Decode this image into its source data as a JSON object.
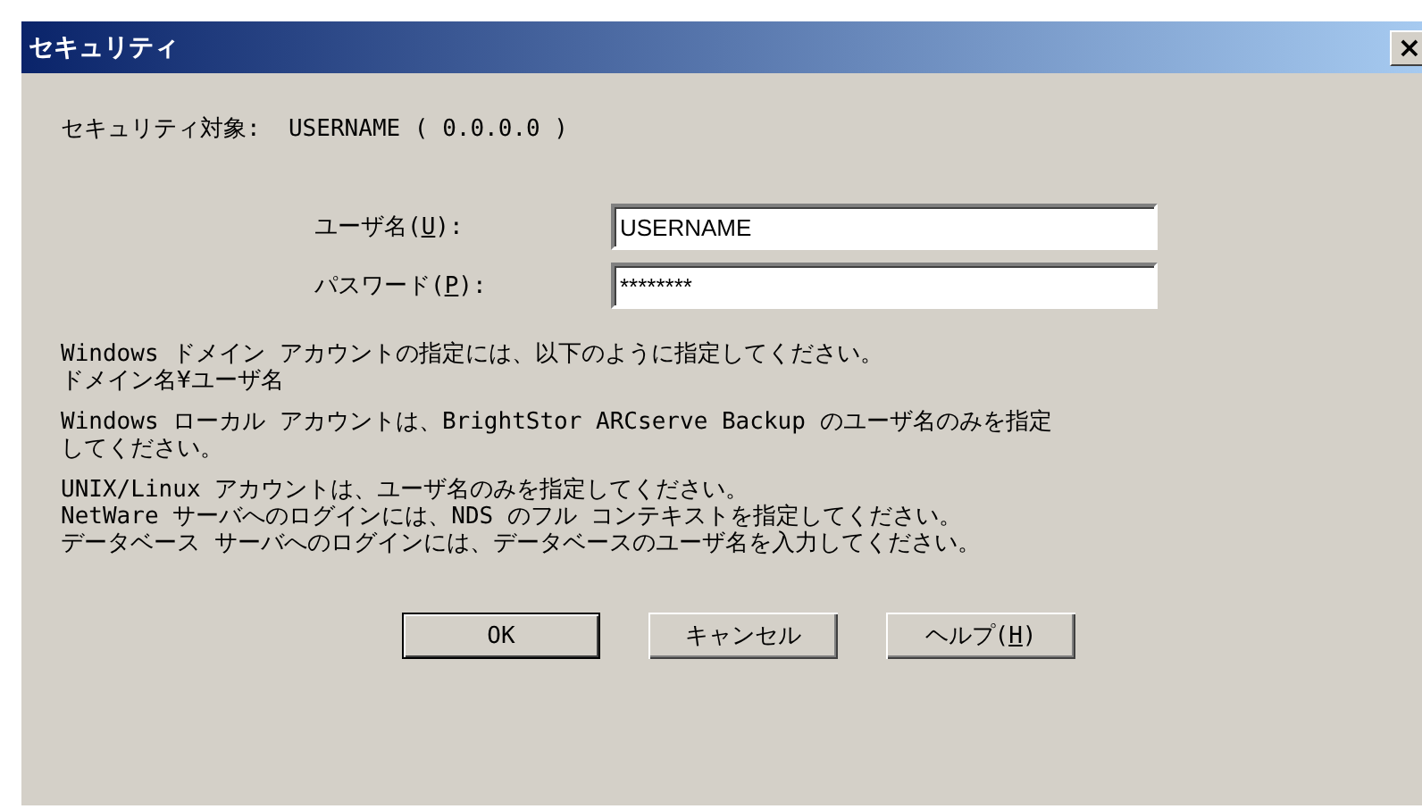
{
  "window": {
    "title": "セキュリティ",
    "close": "×"
  },
  "target": "セキュリティ対象:  USERNAME ( 0.0.0.0 )",
  "fields": [
    {
      "label": {
        "before": "ユーザ名(",
        "key": "U",
        "after": "):"
      },
      "value": "USERNAME"
    },
    {
      "label": {
        "before": "パスワード(",
        "key": "P",
        "after": "):"
      },
      "value": "********"
    }
  ],
  "notes": [
    [
      "Windows ドメイン アカウントの指定には、以下のように指定してください。",
      "ドメイン名¥ユーザ名"
    ],
    [
      "Windows ローカル アカウントは、BrightStor ARCserve Backup のユーザ名のみを指定",
      "してください。"
    ],
    [
      "UNIX/Linux アカウントは、ユーザ名のみを指定してください。",
      "NetWare サーバへのログインには、NDS のフル コンテキストを指定してください。",
      "データベース サーバへのログインには、データベースのユーザ名を入力してください。"
    ]
  ],
  "buttons": [
    {
      "label": {
        "before": "OK"
      },
      "default": true
    },
    {
      "label": {
        "before": "キャンセル"
      },
      "default": false
    },
    {
      "label": {
        "before": "ヘルプ(",
        "key": "H",
        "after": ")"
      },
      "default": false
    }
  ]
}
